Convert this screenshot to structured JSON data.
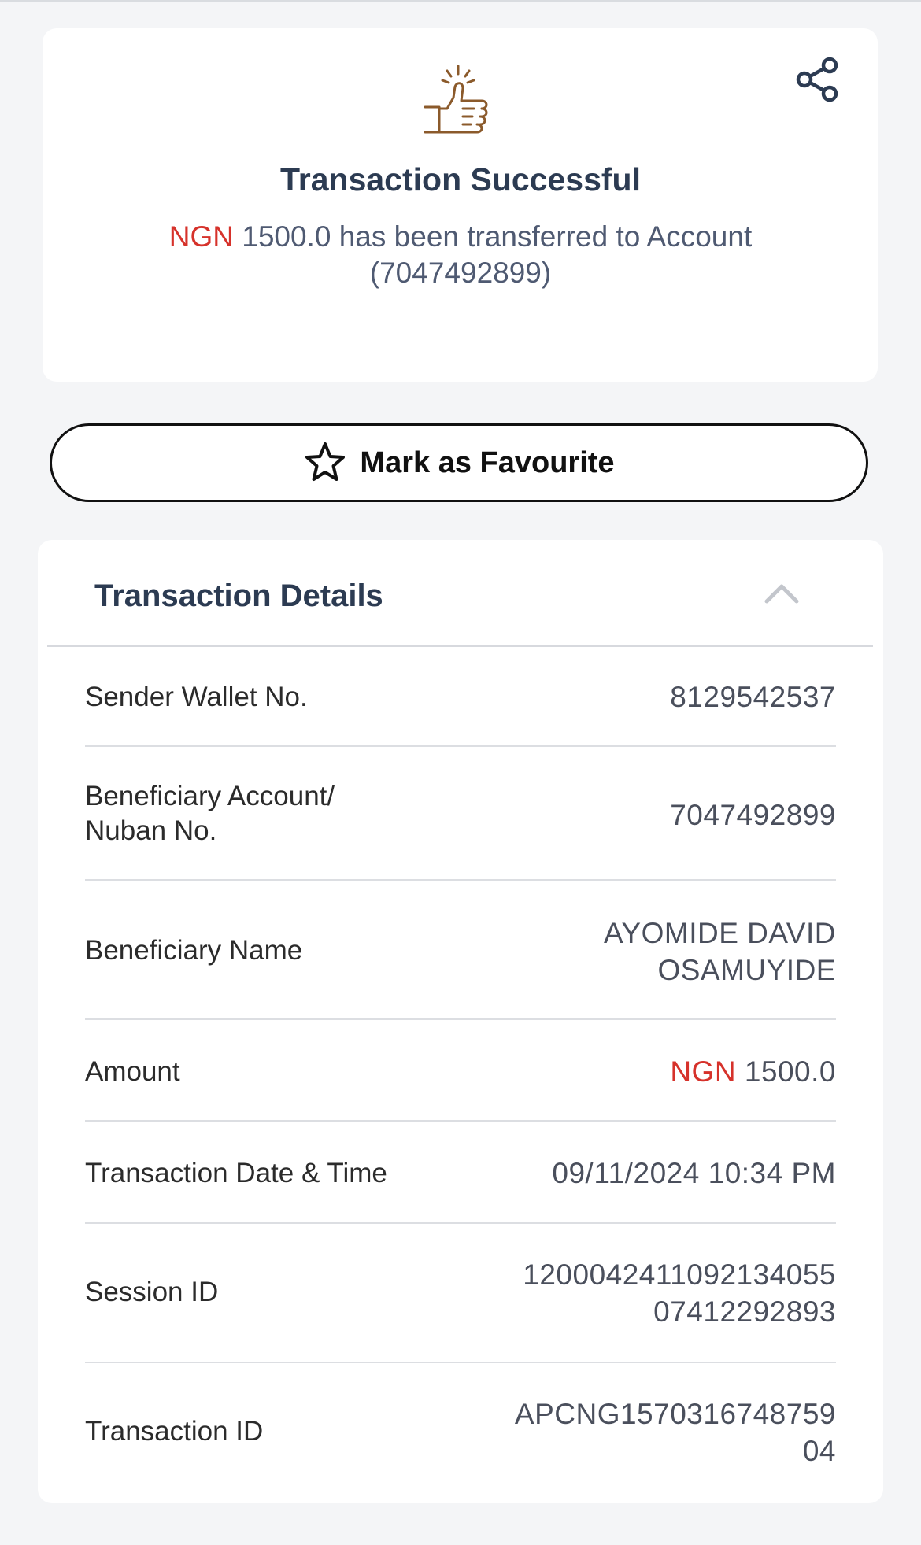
{
  "success": {
    "title": "Transaction Successful",
    "currency": "NGN",
    "message": "1500.0 has been transferred to Account (7047492899)"
  },
  "favourite": {
    "label": "Mark as Favourite"
  },
  "details": {
    "title": "Transaction Details",
    "rows": [
      {
        "label": "Sender Wallet No.",
        "value": "8129542537"
      },
      {
        "label_line1": "Beneficiary Account/",
        "label_line2": "Nuban No.",
        "value": "7047492899"
      },
      {
        "label": "Beneficiary Name",
        "value_line1": "AYOMIDE DAVID",
        "value_line2": "OSAMUYIDE"
      },
      {
        "label": "Amount",
        "currency": "NGN",
        "value": "1500.0"
      },
      {
        "label": "Transaction Date & Time",
        "value": "09/11/2024 10:34 PM"
      },
      {
        "label": "Session ID",
        "value_line1": "1200042411092134055",
        "value_line2": "07412292893"
      },
      {
        "label": "Transaction ID",
        "value_line1": "APCNG1570316748759",
        "value_line2": "04"
      }
    ]
  },
  "colors": {
    "accent_red": "#d6322b",
    "title_navy": "#2c3b52",
    "icon_brown": "#8b5a2b",
    "background": "#f4f5f7"
  },
  "icons": {
    "success": "thumbs-up-icon",
    "share": "share-icon",
    "favourite": "star-outline-icon",
    "collapse": "chevron-up-icon"
  }
}
